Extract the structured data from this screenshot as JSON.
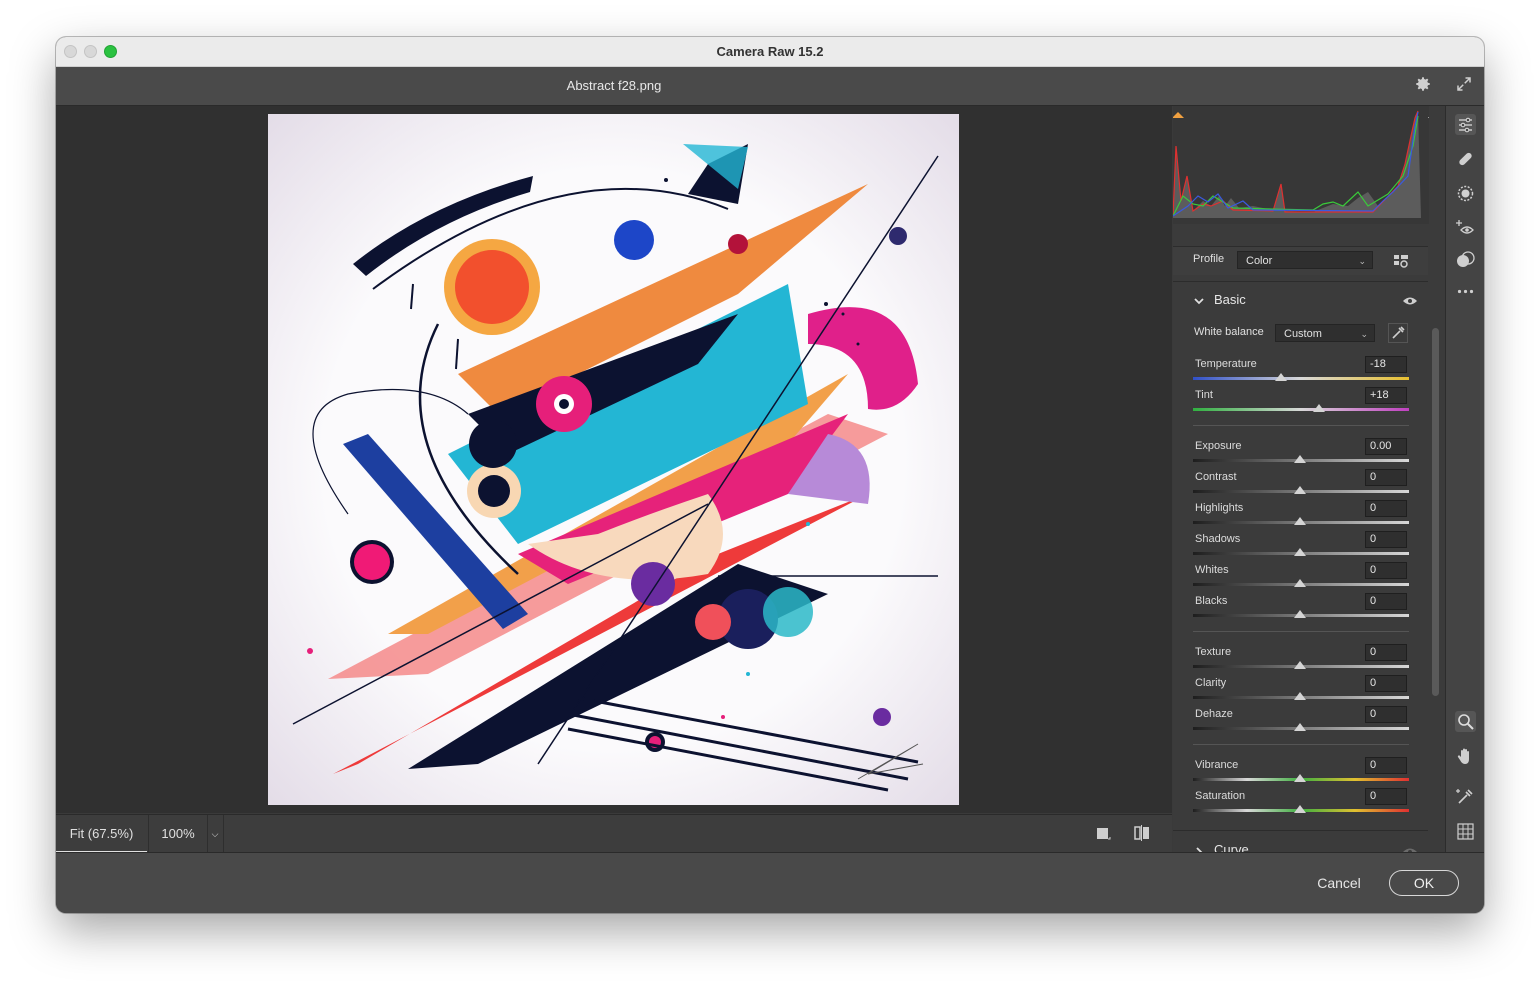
{
  "window": {
    "title": "Camera Raw 15.2"
  },
  "file": {
    "name": "Abstract f28.png"
  },
  "zoom": {
    "fit_label": "Fit (67.5%)",
    "hundred_label": "100%"
  },
  "profile": {
    "label": "Profile",
    "value": "Color"
  },
  "basic": {
    "title": "Basic",
    "white_balance": {
      "label": "White balance",
      "value": "Custom"
    },
    "temperature": {
      "label": "Temperature",
      "value": "-18"
    },
    "tint": {
      "label": "Tint",
      "value": "+18"
    },
    "exposure": {
      "label": "Exposure",
      "value": "0.00"
    },
    "contrast": {
      "label": "Contrast",
      "value": "0"
    },
    "highlights": {
      "label": "Highlights",
      "value": "0"
    },
    "shadows": {
      "label": "Shadows",
      "value": "0"
    },
    "whites": {
      "label": "Whites",
      "value": "0"
    },
    "blacks": {
      "label": "Blacks",
      "value": "0"
    },
    "texture": {
      "label": "Texture",
      "value": "0"
    },
    "clarity": {
      "label": "Clarity",
      "value": "0"
    },
    "dehaze": {
      "label": "Dehaze",
      "value": "0"
    },
    "vibrance": {
      "label": "Vibrance",
      "value": "0"
    },
    "saturation": {
      "label": "Saturation",
      "value": "0"
    }
  },
  "curve": {
    "title": "Curve"
  },
  "footer": {
    "cancel_label": "Cancel",
    "ok_label": "OK"
  },
  "icons": {
    "settings": "gear-icon",
    "fullscreen": "expand-icon",
    "edit": "sliders-icon",
    "heal": "bandage-icon",
    "mask": "mask-icon",
    "redeye": "eye-plus-icon",
    "presets": "presets-icon",
    "more": "more-icon",
    "zoom": "zoom-icon",
    "hand": "hand-icon",
    "sampler": "eyedropper-icon",
    "grid": "grid-icon"
  },
  "colors": {
    "accent": "#e6e6e6",
    "panel": "#3b3b3b",
    "canvas": "#303030"
  }
}
